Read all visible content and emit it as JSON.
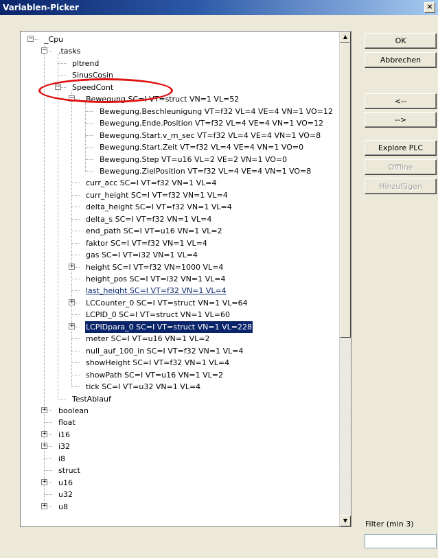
{
  "window": {
    "title": "Variablen-Picker",
    "close_glyph": "×"
  },
  "tree": {
    "rows": [
      {
        "label": "_Cpu",
        "depth": 0,
        "expander": "minus"
      },
      {
        "label": ".tasks",
        "depth": 1,
        "expander": "minus"
      },
      {
        "label": "pltrend",
        "depth": 2,
        "expander": "none"
      },
      {
        "label": "SinusCosin",
        "depth": 2,
        "expander": "none"
      },
      {
        "label": "SpeedCont",
        "depth": 2,
        "expander": "minus"
      },
      {
        "label": "Bewegung SC=I VT=struct VN=1 VL=52",
        "depth": 3,
        "expander": "minus"
      },
      {
        "label": "Bewegung.Beschleunigung VT=f32 VL=4 VE=4 VN=1 VO=12",
        "depth": 4,
        "expander": "none"
      },
      {
        "label": "Bewegung.Ende.Position VT=f32 VL=4 VE=4 VN=1 VO=12",
        "depth": 4,
        "expander": "none"
      },
      {
        "label": "Bewegung.Start.v_m_sec VT=f32 VL=4 VE=4 VN=1 VO=8",
        "depth": 4,
        "expander": "none"
      },
      {
        "label": "Bewegung.Start.Zeit VT=f32 VL=4 VE=4 VN=1 VO=0",
        "depth": 4,
        "expander": "none"
      },
      {
        "label": "Bewegung.Step VT=u16 VL=2 VE=2 VN=1 VO=0",
        "depth": 4,
        "expander": "none"
      },
      {
        "label": "Bewegung.ZielPosition VT=f32 VL=4 VE=4 VN=1 VO=8",
        "depth": 4,
        "expander": "none"
      },
      {
        "label": "curr_acc SC=I VT=f32 VN=1 VL=4",
        "depth": 3,
        "expander": "none"
      },
      {
        "label": "curr_height SC=I VT=f32 VN=1 VL=4",
        "depth": 3,
        "expander": "none"
      },
      {
        "label": "delta_height SC=I VT=f32 VN=1 VL=4",
        "depth": 3,
        "expander": "none"
      },
      {
        "label": "delta_s SC=I VT=f32 VN=1 VL=4",
        "depth": 3,
        "expander": "none"
      },
      {
        "label": "end_path SC=I VT=u16 VN=1 VL=2",
        "depth": 3,
        "expander": "none"
      },
      {
        "label": "faktor SC=I VT=f32 VN=1 VL=4",
        "depth": 3,
        "expander": "none"
      },
      {
        "label": "gas SC=I VT=i32 VN=1 VL=4",
        "depth": 3,
        "expander": "none"
      },
      {
        "label": "height SC=I VT=f32 VN=1000 VL=4",
        "depth": 3,
        "expander": "plus"
      },
      {
        "label": "height_pos SC=I VT=i32 VN=1 VL=4",
        "depth": 3,
        "expander": "none"
      },
      {
        "label": "last_height SC=I VT=f32 VN=1 VL=4",
        "depth": 3,
        "expander": "none",
        "state": "link"
      },
      {
        "label": "LCCounter_0 SC=I VT=struct VN=1 VL=64",
        "depth": 3,
        "expander": "plus"
      },
      {
        "label": "LCPID_0 SC=I VT=struct VN=1 VL=60",
        "depth": 3,
        "expander": "none"
      },
      {
        "label": "LCPIDpara_0 SC=I VT=struct VN=1 VL=228",
        "depth": 3,
        "expander": "plus",
        "state": "selected"
      },
      {
        "label": "meter SC=I VT=u16 VN=1 VL=2",
        "depth": 3,
        "expander": "none"
      },
      {
        "label": "null_auf_100_in SC=I VT=f32 VN=1 VL=4",
        "depth": 3,
        "expander": "none"
      },
      {
        "label": "showHeight SC=I VT=f32 VN=1 VL=4",
        "depth": 3,
        "expander": "none"
      },
      {
        "label": "showPath SC=I VT=u16 VN=1 VL=2",
        "depth": 3,
        "expander": "none"
      },
      {
        "label": "tick SC=I VT=u32 VN=1 VL=4",
        "depth": 3,
        "expander": "none"
      },
      {
        "label": "TestAblauf",
        "depth": 2,
        "expander": "none"
      },
      {
        "label": "boolean",
        "depth": 1,
        "expander": "plus"
      },
      {
        "label": "float",
        "depth": 1,
        "expander": "none"
      },
      {
        "label": "i16",
        "depth": 1,
        "expander": "plus"
      },
      {
        "label": "i32",
        "depth": 1,
        "expander": "plus"
      },
      {
        "label": "i8",
        "depth": 1,
        "expander": "none"
      },
      {
        "label": "struct",
        "depth": 1,
        "expander": "none"
      },
      {
        "label": "u16",
        "depth": 1,
        "expander": "plus"
      },
      {
        "label": "u32",
        "depth": 1,
        "expander": "none"
      },
      {
        "label": "u8",
        "depth": 1,
        "expander": "plus"
      }
    ]
  },
  "buttons": {
    "ok": "OK",
    "cancel": "Abbrechen",
    "left": "<--",
    "right": "-->",
    "explore": "Explore PLC",
    "offline": "Offline",
    "add": "Hinzufügen"
  },
  "filter": {
    "label": "Filter (min 3)",
    "value": ""
  },
  "colors": {
    "highlight_ellipse": "#e01010",
    "selection": "#0a246a"
  }
}
